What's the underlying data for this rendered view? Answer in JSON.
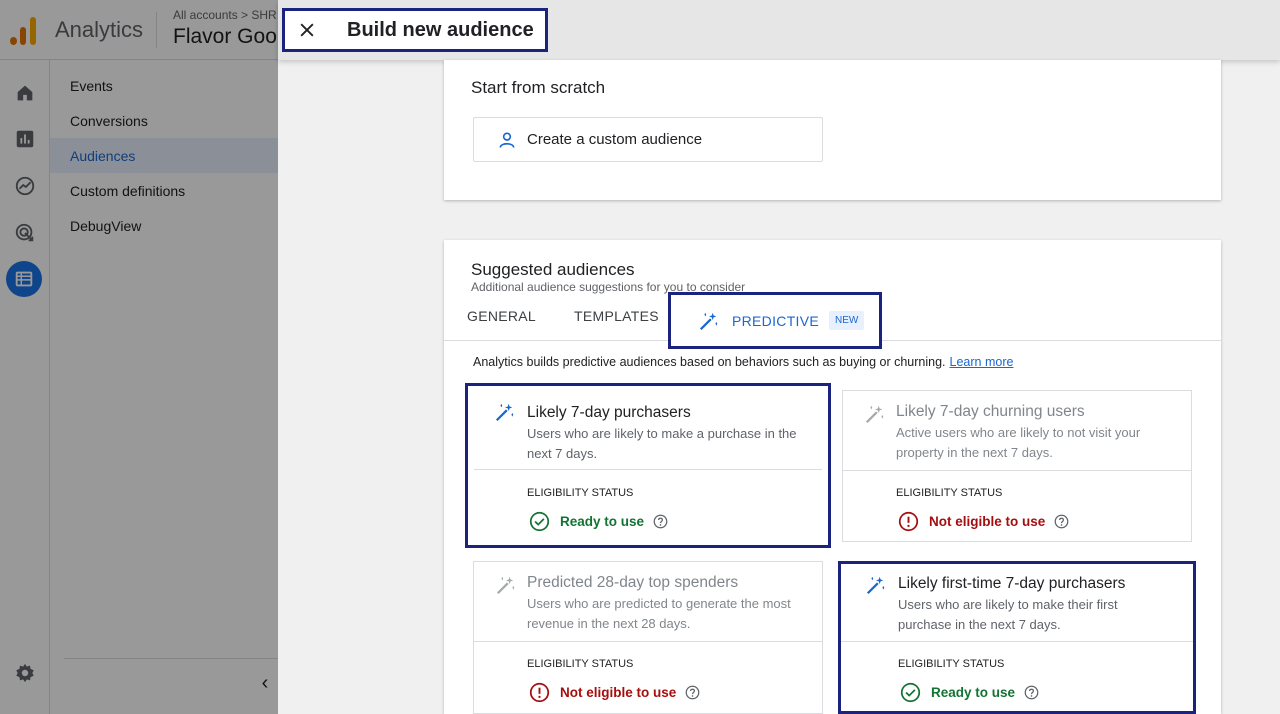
{
  "app": {
    "name": "Analytics",
    "breadcrumb": "All accounts > SHR",
    "property": "Flavor Goo"
  },
  "sidebar": {
    "items": [
      {
        "label": "Events"
      },
      {
        "label": "Conversions"
      },
      {
        "label": "Audiences",
        "active": true
      },
      {
        "label": "Custom definitions"
      },
      {
        "label": "DebugView"
      }
    ],
    "rail_icons": [
      "home-icon",
      "reports-icon",
      "explore-icon",
      "advertising-icon",
      "configure-icon",
      "settings-icon"
    ],
    "collapse_glyph": "‹"
  },
  "dialog": {
    "title": "Build new audience",
    "scratch": {
      "title": "Start from scratch",
      "button": "Create a custom audience"
    },
    "suggested": {
      "title": "Suggested audiences",
      "subtitle": "Additional audience suggestions for you to consider",
      "tabs": {
        "general": "GENERAL",
        "templates": "TEMPLATES",
        "predictive": "PREDICTIVE",
        "new_badge": "NEW"
      },
      "description": "Analytics builds predictive audiences based on behaviors such as buying or churning.",
      "learn_more": "Learn more",
      "audiences": [
        {
          "title": "Likely 7-day purchasers",
          "description": "Users who are likely to make a purchase in the next 7 days.",
          "eligibility_label": "ELIGIBILITY STATUS",
          "status": "Ready to use"
        },
        {
          "title": "Likely 7-day churning users",
          "description": "Active users who are likely to not visit your property in the next 7 days.",
          "eligibility_label": "ELIGIBILITY STATUS",
          "status": "Not eligible to use"
        },
        {
          "title": "Predicted 28-day top spenders",
          "description": "Users who are predicted to generate the most revenue in the next 28 days.",
          "eligibility_label": "ELIGIBILITY STATUS",
          "status": "Not eligible to use"
        },
        {
          "title": "Likely first-time 7-day purchasers",
          "description": "Users who are likely to make their first purchase in the next 7 days.",
          "eligibility_label": "ELIGIBILITY STATUS",
          "status": "Ready to use"
        }
      ]
    }
  },
  "colors": {
    "accent": "#1a73e8",
    "highlight_border": "#1a237e",
    "ready": "#137333",
    "not_eligible": "#a50e0e",
    "logo": "#f9ab00"
  }
}
